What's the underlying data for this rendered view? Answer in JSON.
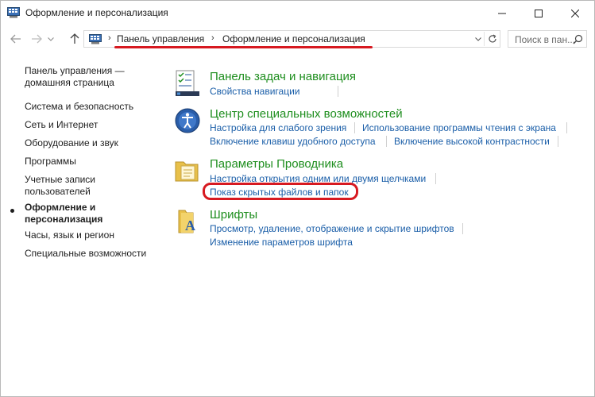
{
  "window": {
    "title": "Оформление и персонализация"
  },
  "address_bar": {
    "crumbs": [
      "Панель управления",
      "Оформление и персонализация"
    ],
    "search_placeholder": "Поиск в пан..."
  },
  "sidebar": {
    "items": [
      {
        "label": "Панель управления — домашняя страница",
        "current": false
      },
      {
        "label": "Система и безопасность",
        "current": false
      },
      {
        "label": "Сеть и Интернет",
        "current": false
      },
      {
        "label": "Оборудование и звук",
        "current": false
      },
      {
        "label": "Программы",
        "current": false
      },
      {
        "label": "Учетные записи пользователей",
        "current": false
      },
      {
        "label": "Оформление и персонализация",
        "current": true
      },
      {
        "label": "Часы, язык и регион",
        "current": false
      },
      {
        "label": "Специальные возможности",
        "current": false
      }
    ]
  },
  "categories": [
    {
      "title": "Панель задач и навигация",
      "icon": "taskbar-icon",
      "links": [
        "Свойства навигации"
      ]
    },
    {
      "title": "Центр специальных возможностей",
      "icon": "accessibility-center-icon",
      "links": [
        "Настройка для слабого зрения",
        "Использование программы чтения с экрана",
        "Включение клавиш удобного доступа",
        "Включение высокой контрастности"
      ]
    },
    {
      "title": "Параметры Проводника",
      "icon": "folder-options-icon",
      "links": [
        "Настройка открытия одним или двумя щелчками",
        "Показ скрытых файлов и папок"
      ]
    },
    {
      "title": "Шрифты",
      "icon": "fonts-folder-icon",
      "links": [
        "Просмотр, удаление, отображение и скрытие шрифтов",
        "Изменение параметров шрифта"
      ]
    }
  ],
  "colors": {
    "category_title": "#1e8e1e",
    "link": "#1a5ea8",
    "annotation": "#d71920"
  }
}
